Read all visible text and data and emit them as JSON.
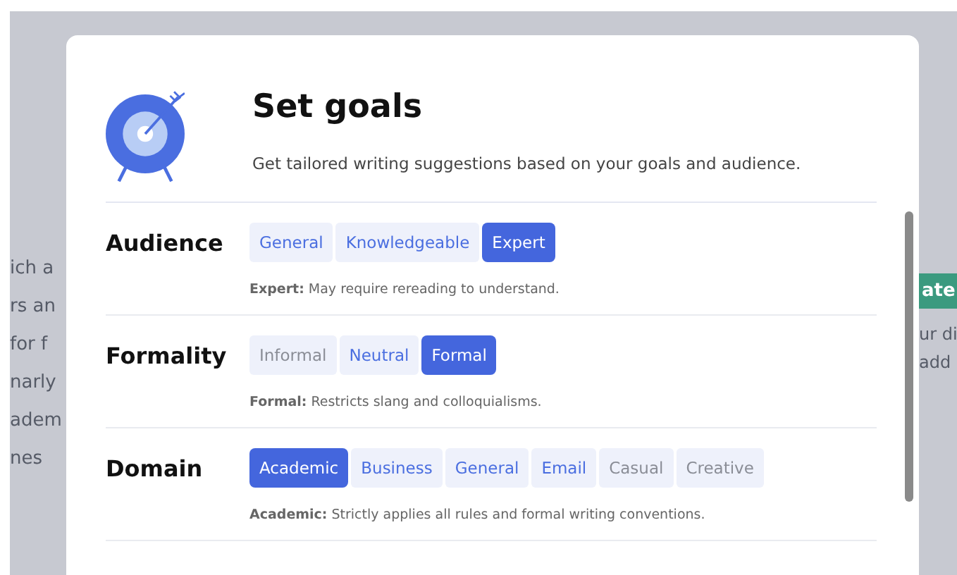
{
  "background": {
    "left_text_lines": [
      "ich a",
      "rs an",
      "for f",
      "narly",
      "adem",
      "nes"
    ],
    "right_button": "ate",
    "right_text_lines": [
      "ur di",
      "add"
    ]
  },
  "dialog": {
    "title": "Set goals",
    "subtitle": "Get tailored writing suggestions based on your goals and audience.",
    "sections": [
      {
        "label": "Audience",
        "options": [
          {
            "label": "General",
            "selected": false,
            "disabled": false
          },
          {
            "label": "Knowledgeable",
            "selected": false,
            "disabled": false
          },
          {
            "label": "Expert",
            "selected": true,
            "disabled": false
          }
        ],
        "description": "**Expert:** May require rereading to understand."
      },
      {
        "label": "Formality",
        "options": [
          {
            "label": "Informal",
            "selected": false,
            "disabled": true
          },
          {
            "label": "Neutral",
            "selected": false,
            "disabled": false
          },
          {
            "label": "Formal",
            "selected": true,
            "disabled": false
          }
        ],
        "description": "**Formal:** Restricts slang and colloquialisms."
      },
      {
        "label": "Domain",
        "options": [
          {
            "label": "Academic",
            "selected": true,
            "disabled": false
          },
          {
            "label": "Business",
            "selected": false,
            "disabled": false
          },
          {
            "label": "General",
            "selected": false,
            "disabled": false
          },
          {
            "label": "Email",
            "selected": false,
            "disabled": false
          },
          {
            "label": "Casual",
            "selected": false,
            "disabled": true
          },
          {
            "label": "Creative",
            "selected": false,
            "disabled": true
          }
        ],
        "description": "**Academic:** Strictly applies all rules and formal writing conventions."
      }
    ]
  }
}
